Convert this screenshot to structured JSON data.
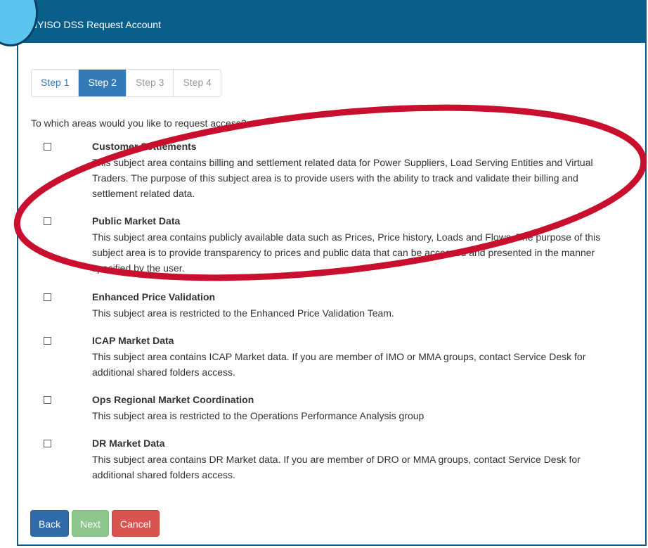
{
  "window": {
    "title": "NYISO DSS Request Account"
  },
  "steps": [
    {
      "label": "Step 1",
      "state": "done"
    },
    {
      "label": "Step 2",
      "state": "active"
    },
    {
      "label": "Step 3",
      "state": "disabled"
    },
    {
      "label": "Step 4",
      "state": "disabled"
    }
  ],
  "question": "To which areas would you like to request access?",
  "options": [
    {
      "name": "Customer Settlements",
      "desc": "This subject area contains billing and settlement related data for Power Suppliers, Load Serving Entities and Virtual Traders. The purpose of this subject area is to provide users with the ability to track and validate their billing and settlement related data.",
      "checked": false
    },
    {
      "name": "Public Market Data",
      "desc": "This subject area contains publicly available data such as Prices, Price history, Loads and Flows. The purpose of this subject area is to provide transparency to prices and public data that can be accessed and presented in the manner specified by the user.",
      "checked": false
    },
    {
      "name": "Enhanced Price Validation",
      "desc": "This subject area is restricted to the Enhanced Price Validation Team.",
      "checked": false
    },
    {
      "name": "ICAP Market Data",
      "desc": "This subject area contains ICAP Market data. If you are member of IMO or MMA groups, contact Service Desk for additional shared folders access.",
      "checked": false
    },
    {
      "name": "Ops Regional Market Coordination",
      "desc": "This subject area is restricted to the Operations Performance Analysis group",
      "checked": false
    },
    {
      "name": "DR Market Data",
      "desc": "This subject area contains DR Market data. If you are member of DRO or MMA groups, contact Service Desk for additional shared folders access.",
      "checked": false
    }
  ],
  "buttons": {
    "back": "Back",
    "next": "Next",
    "cancel": "Cancel"
  },
  "colors": {
    "titlebar": "#0a5e8a",
    "step_active": "#337ab7",
    "annotation_ellipse": "#c8102e",
    "badge": "#5bc4ef"
  }
}
